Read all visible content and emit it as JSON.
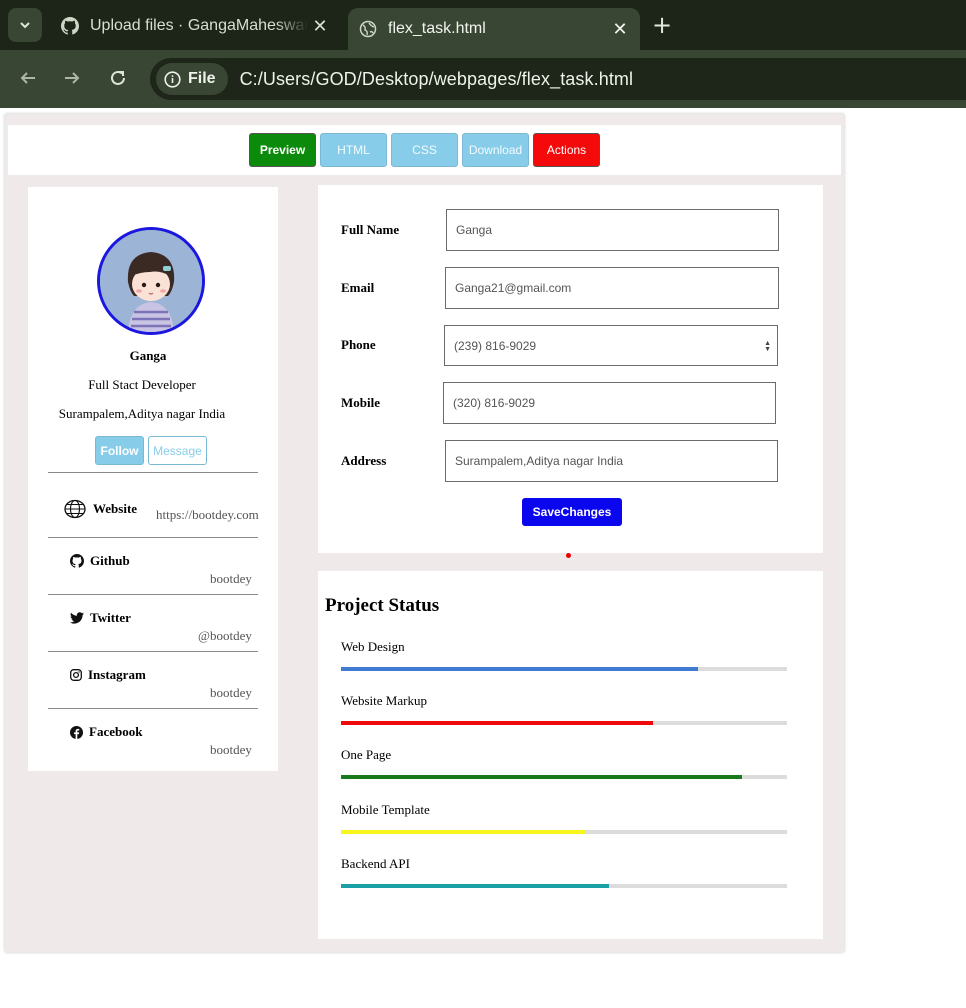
{
  "browser": {
    "tabs": [
      {
        "title": "Upload files · GangaMaheswari",
        "active": false
      },
      {
        "title": "flex_task.html",
        "active": true
      }
    ],
    "chip_label": "File",
    "url": "C:/Users/GOD/Desktop/webpages/flex_task.html"
  },
  "toolbar": {
    "buttons": [
      {
        "label": "Preview",
        "color": "#0b8a0b"
      },
      {
        "label": "HTML",
        "color": "#87cdea"
      },
      {
        "label": "CSS",
        "color": "#87cdea"
      },
      {
        "label": "Download",
        "color": "#87cdea"
      },
      {
        "label": "Actions",
        "color": "#f40a0a"
      }
    ]
  },
  "profile": {
    "name": "Ganga",
    "role": "Full Stact Developer",
    "location": "Surampalem,Aditya nagar India",
    "follow_label": "Follow",
    "message_label": "Message",
    "social": [
      {
        "label": "Website",
        "value": "https://bootdey.com",
        "icon": "globe-icon"
      },
      {
        "label": "Github",
        "value": "bootdey",
        "icon": "github-icon"
      },
      {
        "label": "Twitter",
        "value": "@bootdey",
        "icon": "twitter-icon"
      },
      {
        "label": "Instagram",
        "value": "bootdey",
        "icon": "instagram-icon"
      },
      {
        "label": "Facebook",
        "value": "bootdey",
        "icon": "facebook-icon"
      }
    ]
  },
  "form": {
    "fields": [
      {
        "label": "Full Name",
        "value": "Ganga"
      },
      {
        "label": "Email",
        "value": "Ganga21@gmail.com"
      },
      {
        "label": "Phone",
        "value": "(239) 816-9029"
      },
      {
        "label": "Mobile",
        "value": "(320) 816-9029"
      },
      {
        "label": "Address",
        "value": "Surampalem,Aditya nagar India"
      }
    ],
    "save_label": "SaveChanges"
  },
  "status": {
    "title": "Project Status",
    "items": [
      {
        "label": "Web Design",
        "progress": 0.8,
        "color": "#4279d1"
      },
      {
        "label": "Website Markup",
        "progress": 0.7,
        "color": "#ee0a0a"
      },
      {
        "label": "One Page",
        "progress": 0.9,
        "color": "#187a18"
      },
      {
        "label": "Mobile Template",
        "progress": 0.55,
        "color": "#f7f51e"
      },
      {
        "label": "Backend API",
        "progress": 0.6,
        "color": "#1aa0a6"
      }
    ]
  }
}
